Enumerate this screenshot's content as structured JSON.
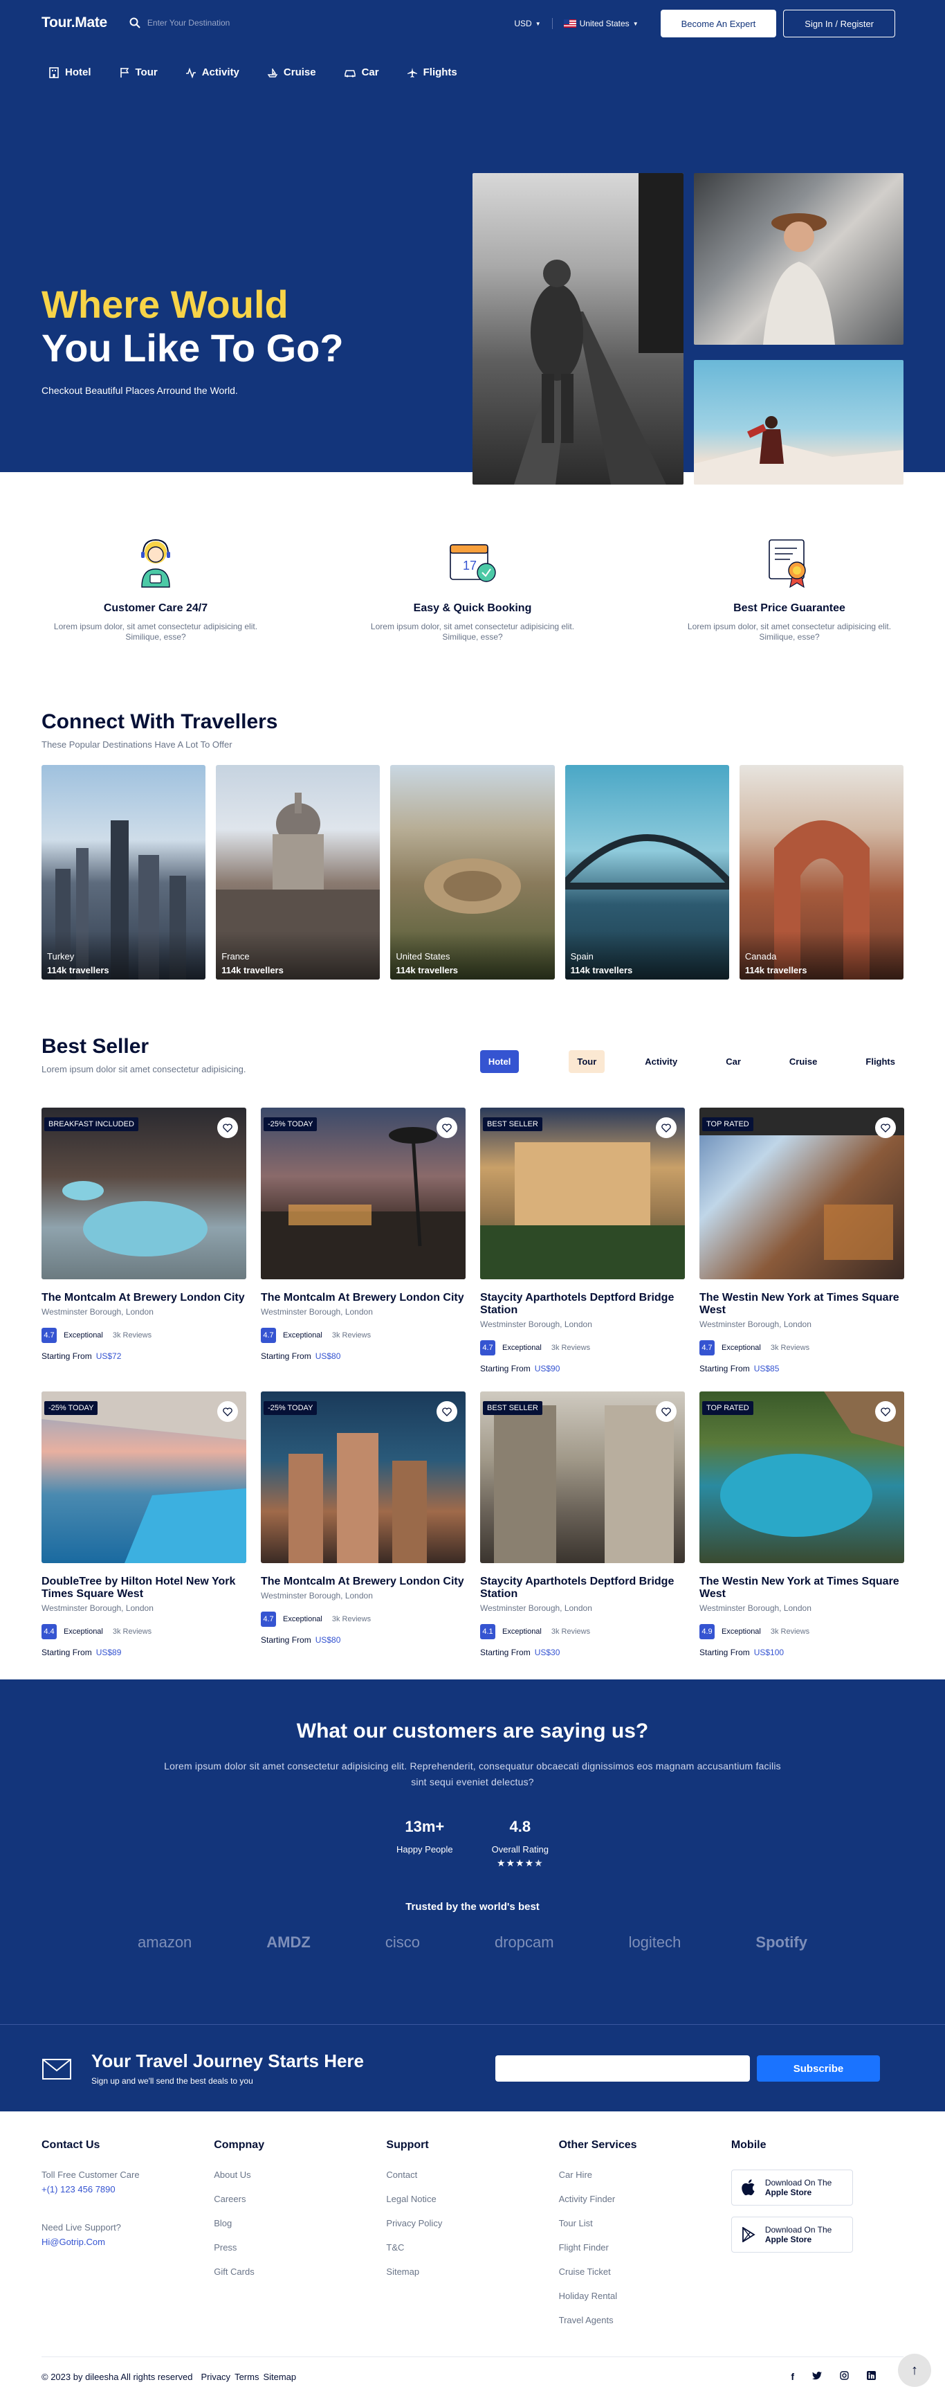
{
  "header": {
    "logo": "Tour.Mate",
    "search_placeholder": "Enter Your Destination",
    "currency": "USD",
    "country": "United States",
    "become_expert": "Become An Expert",
    "sign_in": "Sign In / Register"
  },
  "nav": [
    {
      "label": "Hotel",
      "icon": "hotel-icon"
    },
    {
      "label": "Tour",
      "icon": "flag-icon"
    },
    {
      "label": "Activity",
      "icon": "activity-icon"
    },
    {
      "label": "Cruise",
      "icon": "ship-icon"
    },
    {
      "label": "Car",
      "icon": "car-icon"
    },
    {
      "label": "Flights",
      "icon": "plane-icon"
    }
  ],
  "hero": {
    "title_line1": "Where Would",
    "title_line2": "You Like To Go?",
    "subtitle": "Checkout Beautiful Places Arround the World."
  },
  "features": [
    {
      "title": "Customer Care 24/7",
      "desc": "Lorem ipsum dolor, sit amet consectetur adipisicing elit. Similique, esse?",
      "icon": "customer-care-icon"
    },
    {
      "title": "Easy & Quick Booking",
      "desc": "Lorem ipsum dolor, sit amet consectetur adipisicing elit. Similique, esse?",
      "icon": "calendar-icon"
    },
    {
      "title": "Best Price Guarantee",
      "desc": "Lorem ipsum dolor, sit amet consectetur adipisicing elit. Similique, esse?",
      "icon": "certificate-icon"
    }
  ],
  "connect": {
    "title": "Connect With Travellers",
    "subtitle": "These Popular Destinations Have A Lot To Offer",
    "destinations": [
      {
        "name": "Turkey",
        "count": "114k travellers"
      },
      {
        "name": "France",
        "count": "114k travellers"
      },
      {
        "name": "United States",
        "count": "114k travellers"
      },
      {
        "name": "Spain",
        "count": "114k travellers"
      },
      {
        "name": "Canada",
        "count": "114k travellers"
      }
    ]
  },
  "best_seller": {
    "title": "Best Seller",
    "subtitle": "Lorem ipsum dolor sit amet consectetur adipisicing.",
    "tabs": [
      "Hotel",
      "Tour",
      "Activity",
      "Car",
      "Cruise",
      "Flights"
    ],
    "starting_from": "Starting From",
    "cards": [
      {
        "badge": "BREAKFAST INCLUDED",
        "title": "The Montcalm At Brewery London City",
        "location": "Westminster Borough, London",
        "rating": "4.7",
        "rating_label": "Exceptional",
        "reviews": "3k Reviews",
        "price": "US$72"
      },
      {
        "badge": "-25% TODAY",
        "title": "The Montcalm At Brewery London City",
        "location": "Westminster Borough, London",
        "rating": "4.7",
        "rating_label": "Exceptional",
        "reviews": "3k Reviews",
        "price": "US$80"
      },
      {
        "badge": "BEST SELLER",
        "title": "Staycity Aparthotels Deptford Bridge Station",
        "location": "Westminster Borough, London",
        "rating": "4.7",
        "rating_label": "Exceptional",
        "reviews": "3k Reviews",
        "price": "US$90"
      },
      {
        "badge": "TOP RATED",
        "title": "The Westin New York at Times Square West",
        "location": "Westminster Borough, London",
        "rating": "4.7",
        "rating_label": "Exceptional",
        "reviews": "3k Reviews",
        "price": "US$85"
      },
      {
        "badge": "-25% TODAY",
        "title": "DoubleTree by Hilton Hotel New York Times Square West",
        "location": "Westminster Borough, London",
        "rating": "4.4",
        "rating_label": "Exceptional",
        "reviews": "3k Reviews",
        "price": "US$89"
      },
      {
        "badge": "-25% TODAY",
        "title": "The Montcalm At Brewery London City",
        "location": "Westminster Borough, London",
        "rating": "4.7",
        "rating_label": "Exceptional",
        "reviews": "3k Reviews",
        "price": "US$80"
      },
      {
        "badge": "BEST SELLER",
        "title": "Staycity Aparthotels Deptford Bridge Station",
        "location": "Westminster Borough, London",
        "rating": "4.1",
        "rating_label": "Exceptional",
        "reviews": "3k Reviews",
        "price": "US$30"
      },
      {
        "badge": "TOP RATED",
        "title": "The Westin New York at Times Square West",
        "location": "Westminster Borough, London",
        "rating": "4.9",
        "rating_label": "Exceptional",
        "reviews": "3k Reviews",
        "price": "US$100"
      }
    ]
  },
  "testimonials": {
    "title": "What our customers are saying us?",
    "desc": "Lorem ipsum dolor sit amet consectetur adipisicing elit. Reprehenderit, consequatur obcaecati dignissimos eos magnam accusantium facilis sint sequi eveniet delectus?",
    "stats": [
      {
        "value": "13m+",
        "label": "Happy People"
      },
      {
        "value": "4.8",
        "label": "Overall Rating"
      }
    ],
    "trusted": "Trusted by the world's best",
    "brands": [
      "amazon",
      "AMDZ",
      "cisco",
      "dropcam",
      "logitech",
      "Spotify"
    ]
  },
  "newsletter": {
    "title": "Your Travel Journey Starts Here",
    "subtitle": "Sign up and we'll send the best deals to you",
    "button": "Subscribe"
  },
  "footer": {
    "contact": {
      "heading": "Contact Us",
      "care_label": "Toll Free Customer Care",
      "phone": "+(1) 123 456 7890",
      "support_label": "Need Live Support?",
      "email": "Hi@Gotrip.Com"
    },
    "company": {
      "heading": "Compnay",
      "links": [
        "About Us",
        "Careers",
        "Blog",
        "Press",
        "Gift Cards"
      ]
    },
    "support": {
      "heading": "Support",
      "links": [
        "Contact",
        "Legal Notice",
        "Privacy Policy",
        "T&C",
        "Sitemap"
      ]
    },
    "other": {
      "heading": "Other Services",
      "links": [
        "Car Hire",
        "Activity Finder",
        "Tour List",
        "Flight Finder",
        "Cruise Ticket",
        "Holiday Rental",
        "Travel Agents"
      ]
    },
    "mobile": {
      "heading": "Mobile",
      "apps": [
        {
          "line1": "Download On The",
          "line2": "Apple Store"
        },
        {
          "line1": "Download On The",
          "line2": "Apple Store"
        }
      ]
    },
    "copyright": "© 2023 by dileesha All rights reserved",
    "bottom_links": [
      "Privacy",
      "Terms",
      "Sitemap"
    ]
  },
  "colors": {
    "primary_blue": "#13357b",
    "accent_yellow": "#f8d448",
    "button_blue": "#3554d1"
  }
}
